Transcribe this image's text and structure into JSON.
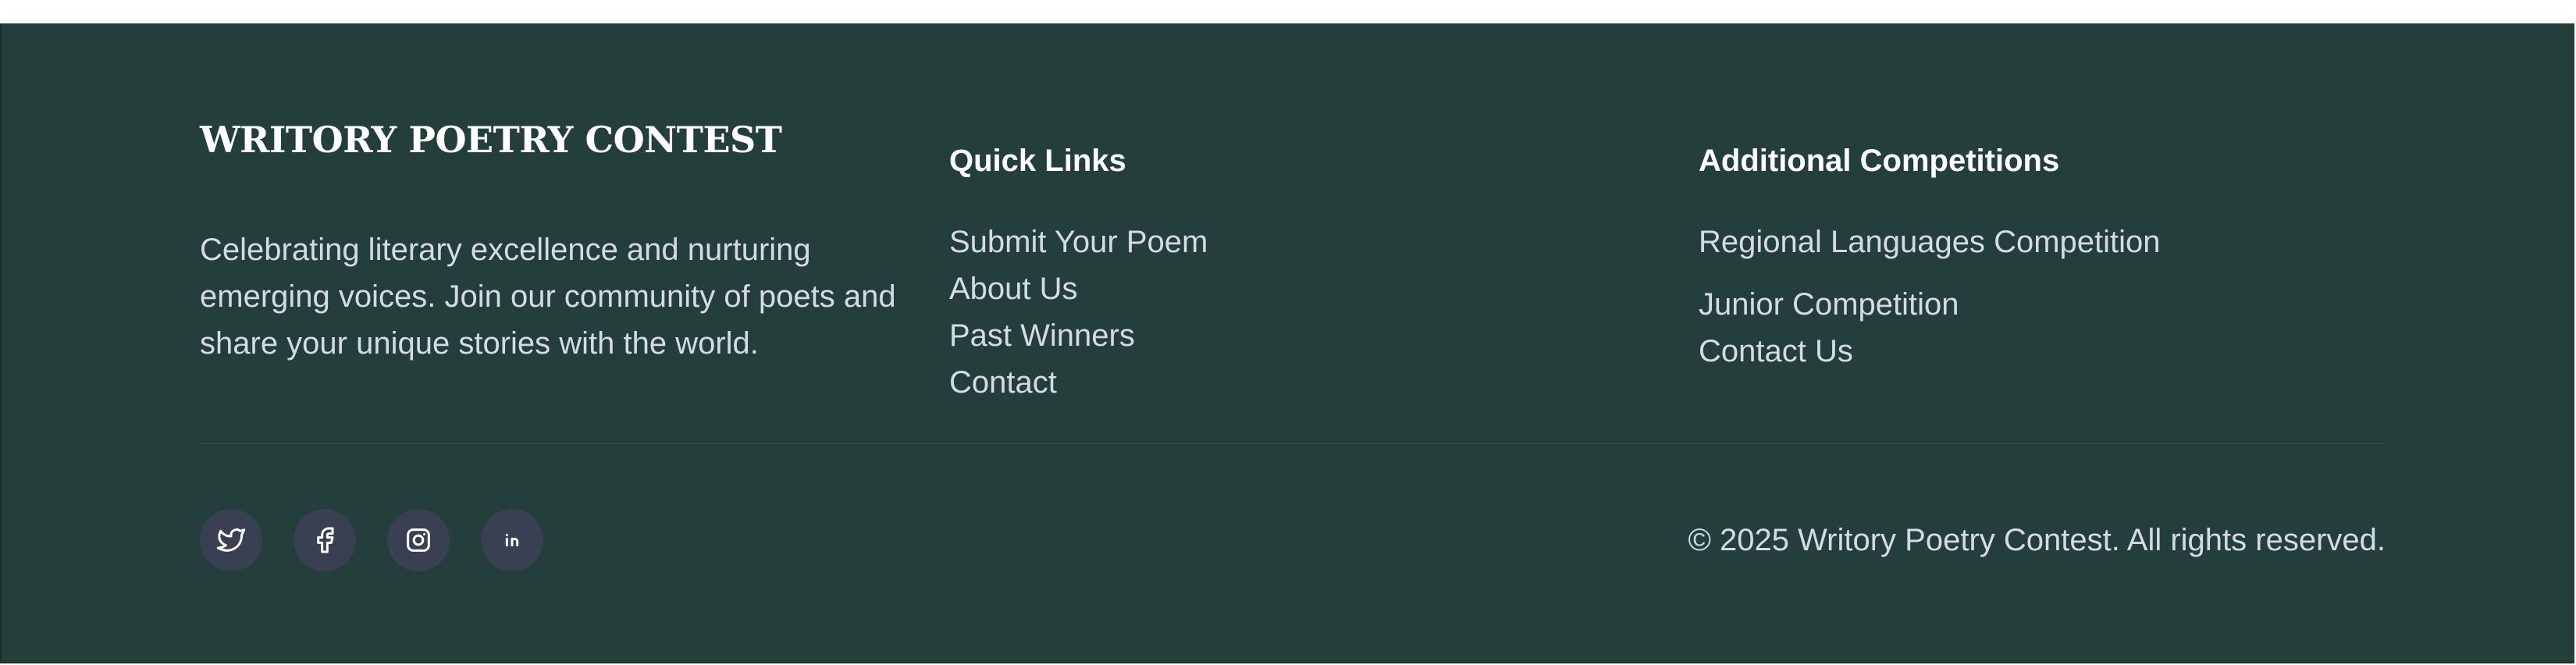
{
  "brand": {
    "title": "WRITORY POETRY CONTEST",
    "description": "Celebrating literary excellence and nurturing emerging voices. Join our community of poets and share your unique stories with the world."
  },
  "quick_links": {
    "title": "Quick Links",
    "items": [
      {
        "label": "Submit Your Poem"
      },
      {
        "label": "About Us"
      },
      {
        "label": "Past Winners"
      },
      {
        "label": "Contact"
      }
    ]
  },
  "additional": {
    "title": "Additional Competitions",
    "items": [
      {
        "label": "Regional Languages Competition"
      },
      {
        "label": "Junior Competition"
      },
      {
        "label": "Contact Us"
      }
    ]
  },
  "social": [
    {
      "icon": "twitter-icon"
    },
    {
      "icon": "facebook-icon"
    },
    {
      "icon": "instagram-icon"
    },
    {
      "icon": "linkedin-icon"
    }
  ],
  "copyright": "© 2025 Writory Poetry Contest. All rights reserved.",
  "colors": {
    "footer_bg": "#243e3b",
    "text": "#d4dbe1",
    "heading": "#ffffff",
    "social_bg": "#394052"
  }
}
